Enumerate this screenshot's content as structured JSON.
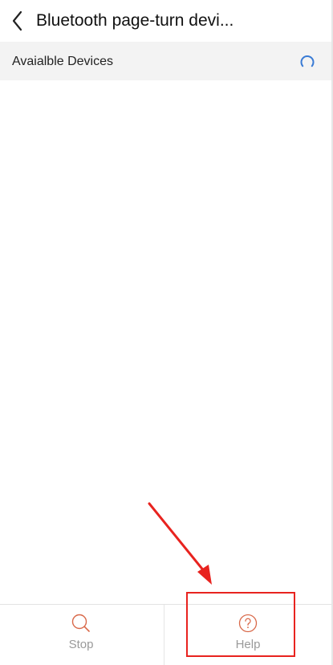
{
  "header": {
    "title": "Bluetooth page-turn devi...",
    "back_icon": "chevron-left-icon"
  },
  "section": {
    "label": "Avaialble Devices",
    "status_icon": "loading-spinner-icon"
  },
  "device_list": [],
  "bottom_bar": {
    "stop": {
      "label": "Stop",
      "icon": "search-icon"
    },
    "help": {
      "label": "Help",
      "icon": "question-circle-icon"
    }
  },
  "colors": {
    "accent_icon": "#d9694a",
    "spinner": "#3a7bd5",
    "annotation": "#e8231f",
    "label_gray": "#9a9a9a"
  }
}
